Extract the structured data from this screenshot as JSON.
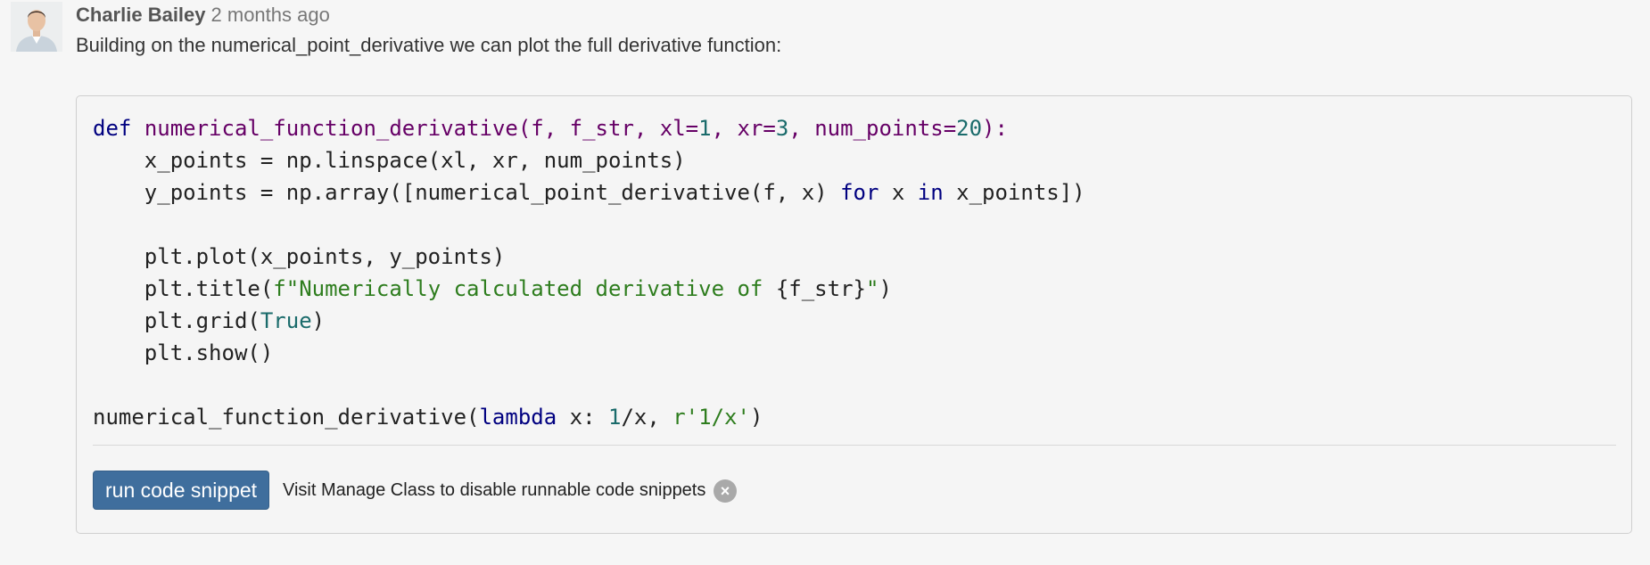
{
  "post": {
    "author": "Charlie Bailey",
    "time": "2 months ago",
    "body": "Building on the numerical_point_derivative we can plot the full derivative function:"
  },
  "code": {
    "line1": {
      "kw_def": "def",
      "name": "numerical_function_derivative",
      "p1": "(f, f_str, xl=",
      "n1": "1",
      "p2": ", xr=",
      "n2": "3",
      "p3": ", num_points=",
      "n3": "20",
      "p4": "):"
    },
    "line2": "    x_points = np.linspace(xl, xr, num_points)",
    "line3": {
      "a": "    y_points = np.array([numerical_point_derivative(f, x) ",
      "kw_for": "for",
      "b": " x ",
      "kw_in": "in",
      "c": " x_points])"
    },
    "line5": "    plt.plot(x_points, y_points)",
    "line6": {
      "a": "    plt.title(",
      "str1": "f\"Numerically calculated derivative of ",
      "b": "{f_str}",
      "str2": "\"",
      "c": ")"
    },
    "line7": {
      "a": "    plt.grid(",
      "val": "True",
      "c": ")"
    },
    "line8": "    plt.show()",
    "line10": {
      "a": "numerical_function_derivative(",
      "kw_lambda": "lambda",
      "b": " x: ",
      "num": "1",
      "c": "/x, ",
      "str": "r'1/x'",
      "d": ")"
    }
  },
  "controls": {
    "run_label": "run code snippet",
    "notice": "Visit Manage Class to disable runnable code snippets",
    "close_glyph": "×"
  },
  "colors": {
    "keyword": "#000080",
    "function_name": "#660066",
    "number": "#1a6b6b",
    "string": "#2e7d1e",
    "button": "#3f6e9d"
  }
}
